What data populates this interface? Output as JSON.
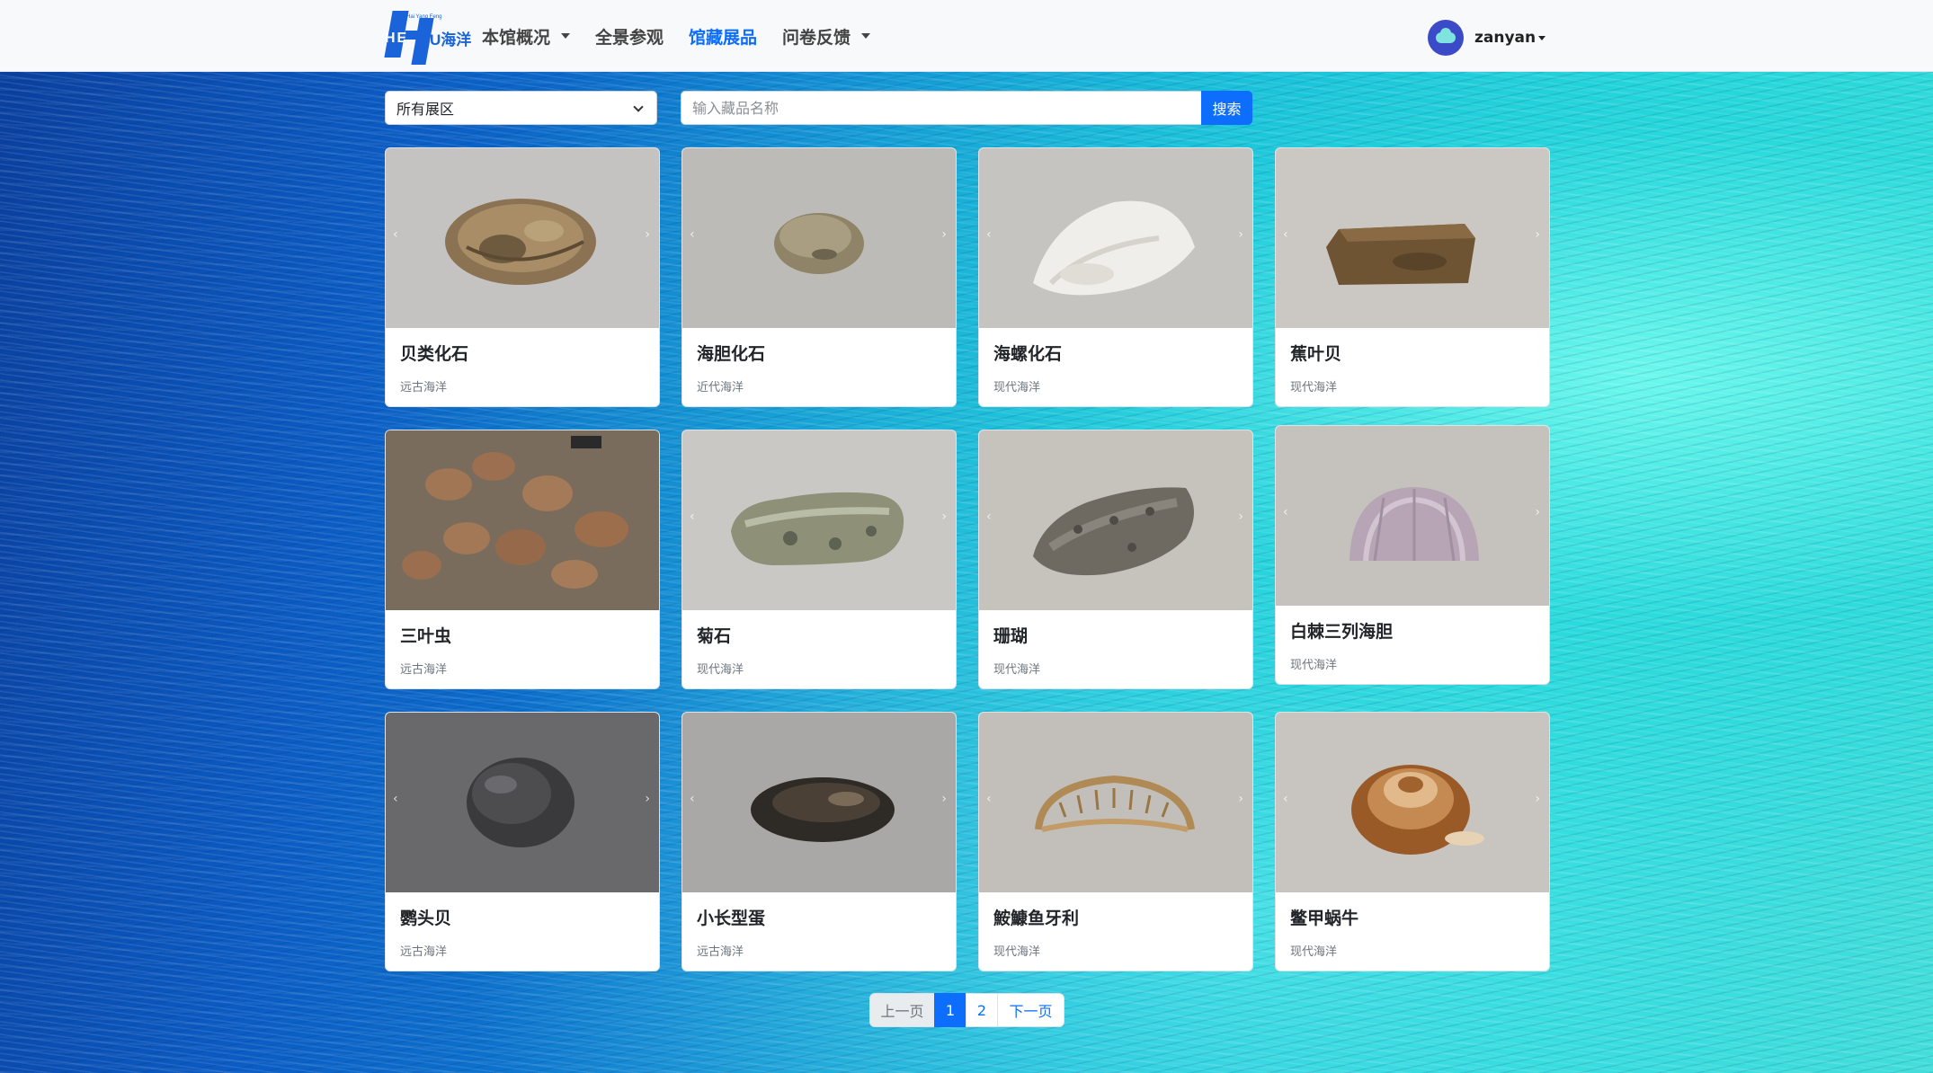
{
  "brand": {
    "tiny": "Hai Yang Feng",
    "he": "HE",
    "name": "U海洋"
  },
  "nav": {
    "items": [
      {
        "label": "本馆概况",
        "dropdown": true
      },
      {
        "label": "全景参观",
        "dropdown": false
      },
      {
        "label": "馆藏展品",
        "dropdown": false,
        "active": true
      },
      {
        "label": "问卷反馈",
        "dropdown": true
      }
    ]
  },
  "user": {
    "name": "zanyan"
  },
  "filters": {
    "area_select": "所有展区",
    "search_placeholder": "输入藏品名称",
    "search_button": "搜索"
  },
  "exhibits": [
    {
      "title": "贝类化石",
      "era": "远古海洋"
    },
    {
      "title": "海胆化石",
      "era": "近代海洋"
    },
    {
      "title": "海螺化石",
      "era": "现代海洋"
    },
    {
      "title": "蕉叶贝",
      "era": "现代海洋"
    },
    {
      "title": "三叶虫",
      "era": "远古海洋"
    },
    {
      "title": "菊石",
      "era": "现代海洋"
    },
    {
      "title": "珊瑚",
      "era": "现代海洋"
    },
    {
      "title": "白棘三列海胆",
      "era": "现代海洋"
    },
    {
      "title": "鹦头贝",
      "era": "远古海洋"
    },
    {
      "title": "小长型蛋",
      "era": "远古海洋"
    },
    {
      "title": "鮟鱇鱼牙利",
      "era": "现代海洋"
    },
    {
      "title": "鳖甲蜗牛",
      "era": "现代海洋"
    }
  ],
  "carousel": {
    "prev": "‹",
    "next": "›"
  },
  "pagination": {
    "prev": "上一页",
    "pages": [
      "1",
      "2"
    ],
    "current": "1",
    "next": "下一页"
  }
}
